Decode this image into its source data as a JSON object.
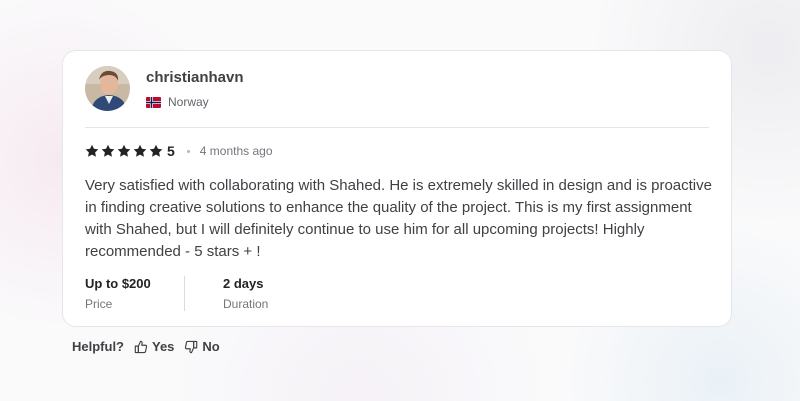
{
  "review": {
    "username": "christianhavn",
    "country": "Norway",
    "rating_value": "5",
    "stars_filled": 5,
    "time_ago": "4 months ago",
    "text": "Very satisfied with collaborating with Shahed. He is extremely skilled in design and is proactive in finding creative solutions to enhance the quality of the project. This is my first assignment with Shahed, but I will definitely continue to use him for all upcoming projects! Highly recommended - 5 stars + !",
    "price": {
      "value": "Up to $200",
      "label": "Price"
    },
    "duration": {
      "value": "2 days",
      "label": "Duration"
    }
  },
  "helpful": {
    "label": "Helpful?",
    "yes_label": "Yes",
    "no_label": "No"
  },
  "icons": {
    "avatar": "avatar-photo",
    "flag": "norway-flag-icon",
    "star": "star-icon",
    "thumbs_up": "thumbs-up-icon",
    "thumbs_down": "thumbs-down-icon"
  },
  "colors": {
    "star": "#222325",
    "text": "#404145",
    "muted": "#74767e"
  }
}
